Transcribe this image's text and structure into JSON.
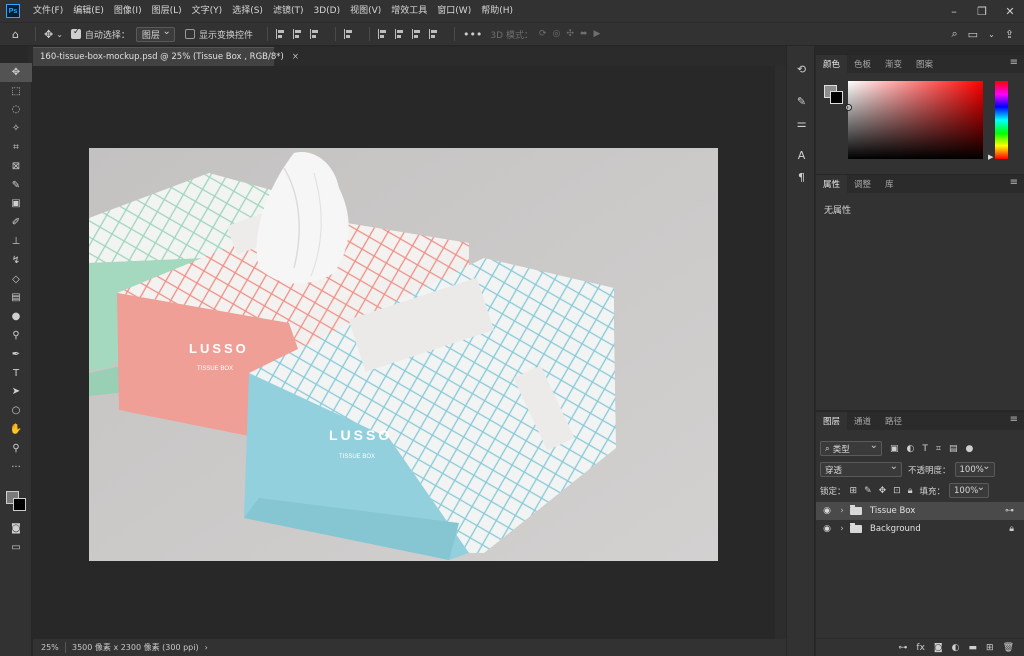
{
  "app": {
    "logo": "Ps"
  },
  "menu": [
    "文件(F)",
    "编辑(E)",
    "图像(I)",
    "图层(L)",
    "文字(Y)",
    "选择(S)",
    "滤镜(T)",
    "3D(D)",
    "视图(V)",
    "增效工具",
    "窗口(W)",
    "帮助(H)"
  ],
  "options": {
    "auto_select_label": "自动选择：",
    "auto_select_target": "图层",
    "show_transform_label": "显示变换控件",
    "more": "•••",
    "mode_3d": "3D 模式："
  },
  "document": {
    "tab_title": "160-tissue-box-mockup.psd @ 25% (Tissue Box , RGB/8*)",
    "close": "×",
    "brand": "LUSSO",
    "product": "TISSUE BOX"
  },
  "status": {
    "zoom": "25%",
    "info": "3500 像素 x 2300 像素 (300 ppi)",
    "arrow": "›"
  },
  "panels": {
    "color_tabs": [
      "颜色",
      "色板",
      "渐变",
      "图案"
    ],
    "props_tabs": [
      "属性",
      "调整",
      "库"
    ],
    "props_empty": "无属性",
    "layers_tabs": [
      "图层",
      "通道",
      "路径"
    ]
  },
  "layers": {
    "filter_kind": "类型",
    "blend_mode": "穿透",
    "opacity_label": "不透明度：",
    "opacity_value": "100%",
    "lock_label": "锁定：",
    "fill_label": "填充：",
    "fill_value": "100%",
    "items": [
      {
        "name": "Tissue Box",
        "selected": true
      },
      {
        "name": "Background",
        "selected": false
      }
    ]
  },
  "colors": {
    "accent": "#31a8ff",
    "foreground_swatch": "#8e8e8e",
    "background_swatch": "#000000",
    "box_pink": "#ee9e95",
    "box_blue": "#8fcfdc",
    "box_green": "#a2d7bd"
  }
}
